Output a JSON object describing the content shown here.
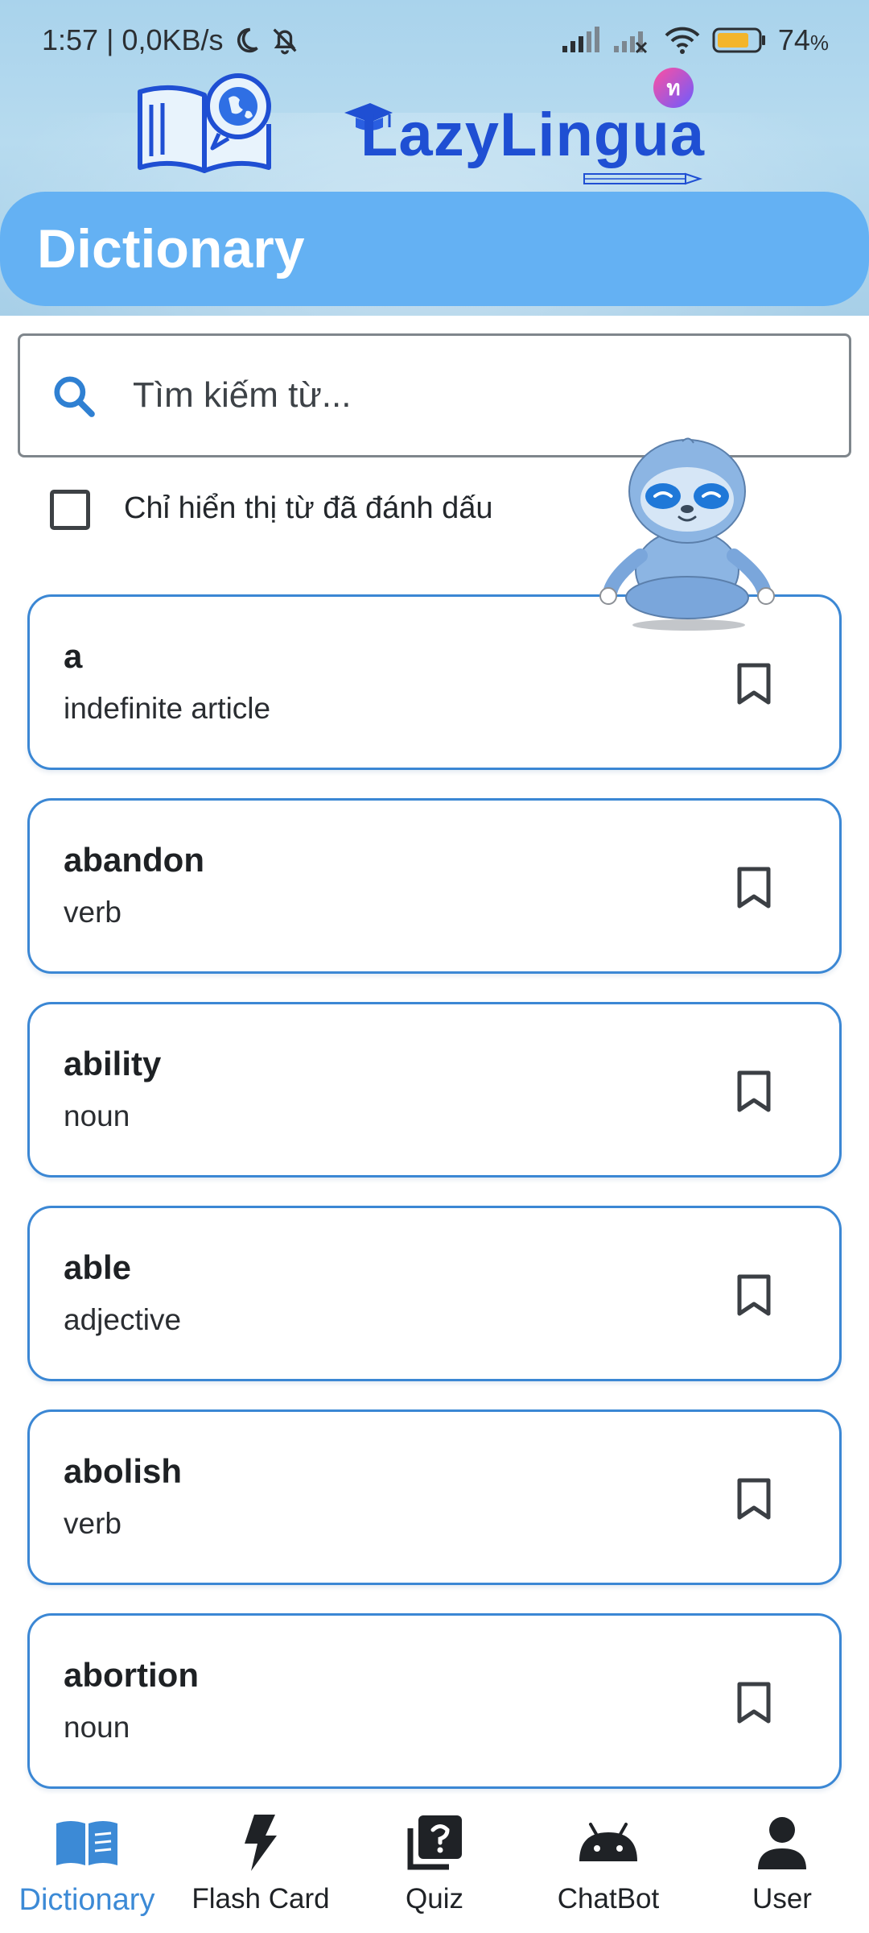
{
  "status_bar": {
    "time_speed": "1:57 | 0,0KB/s",
    "battery": "74",
    "battery_unit": "%"
  },
  "brand": {
    "name": "LazyLingua",
    "badge_text": "ท"
  },
  "header": {
    "title": "Dictionary"
  },
  "search": {
    "placeholder": "Tìm kiếm từ..."
  },
  "filter": {
    "label": "Chỉ hiển thị từ đã đánh dấu",
    "checked": false
  },
  "words": [
    {
      "word": "a",
      "type": "indefinite article"
    },
    {
      "word": "abandon",
      "type": "verb"
    },
    {
      "word": "ability",
      "type": "noun"
    },
    {
      "word": "able",
      "type": "adjective"
    },
    {
      "word": "abolish",
      "type": "verb"
    },
    {
      "word": "abortion",
      "type": "noun"
    }
  ],
  "nav": {
    "items": [
      {
        "label": "Dictionary",
        "icon": "book-icon"
      },
      {
        "label": "Flash Card",
        "icon": "flash-icon"
      },
      {
        "label": "Quiz",
        "icon": "quiz-icon"
      },
      {
        "label": "ChatBot",
        "icon": "android-icon"
      },
      {
        "label": "User",
        "icon": "person-icon"
      }
    ],
    "active": "Dictionary"
  },
  "colors": {
    "accent": "#3c8ad6",
    "banner": "#64b1f3",
    "card_border": "#3b87d4",
    "brand_text": "#1f4fd3"
  }
}
